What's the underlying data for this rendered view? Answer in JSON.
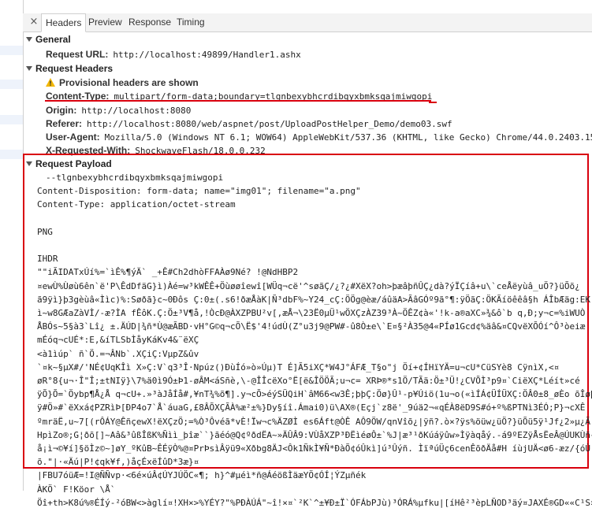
{
  "tabs": {
    "close": "×",
    "items": [
      {
        "label": "Headers"
      },
      {
        "label": "Preview"
      },
      {
        "label": "Response"
      },
      {
        "label": "Timing"
      }
    ]
  },
  "general": {
    "title": "General",
    "request_url_key": "Request URL:",
    "request_url_value": "http://localhost:49899/Handler1.ashx"
  },
  "request_headers": {
    "title": "Request Headers",
    "provisional": "Provisional headers are shown",
    "rows": [
      {
        "key": "Content-Type:",
        "value": "multipart/form-data;boundary=tlgnbexybhcrdibqyxbmksqajmiwgopi"
      },
      {
        "key": "Origin:",
        "value": "http://localhost:8080"
      },
      {
        "key": "Referer:",
        "value": "http://localhost:8080/web/aspnet/post/UploadPostHelper_Demo/demo03.swf"
      },
      {
        "key": "User-Agent:",
        "value": "Mozilla/5.0 (Windows NT 6.1; WOW64) AppleWebKit/537.36 (KHTML, like Gecko) Chrome/44.0.2403.15"
      },
      {
        "key": "X-Requested-With:",
        "value": "ShockwaveFlash/18.0.0.232"
      }
    ]
  },
  "payload": {
    "title": "Request Payload",
    "lines": [
      "--tlgnbexybhcrdibqyxbmksqajmiwgopi",
      "Content-Disposition: form-data; name=\"img01\"; filename=\"a.png\"",
      "Content-Type: application/octet-stream",
      "",
      "PNG",
      "",
      "IHDR",
      "\"\"iÃIDATxÚí%=`ìÊ%¶ýÄ` _+Ê#Ch2dhòFFAÀø9Né? !@NdHBP2",
      "¤ewÙ%Ùøù6ên`ë'P\\ÊdDfäG}ì)Àé=w³kWÊÊ+Öùøøîewî[WÜq¬cë'^søãÇ/¿?¿#XëX?oh>þæâþñÛÇ¿dà?ýÏÇíâ+u\\`ceÅëyùâ_uÖ?}üÕõ¿",
      "ã9ÿì}þ3gèùâ«Ììc)%:Søðã}c~0Ðôs Ç:0±(.s6!ðæÅàK|Ñ³dbF%~Y24_cÇ:ÖÖg@èæ/áûäA>ÃâGÓº9ã°¶:ÿÖãÇ:ÖKÃíöêêâ§h ÁÎbÆäg:EK(",
      "ì~w8GÆaZàVÌ/-æ?ÌA fÊôK.Ç:Ö±³V¶å,!ÒcÐ@ÀXZPBU²v[,æÅ¬\\23Ë0µÜ¹wÖXÇzÀZ39³À~ÖÊZ¢à«'!k-a®aXC»¾&ô`b q,Ð;y¬c=%iWUÒ",
      "ÅBÓs~5§à3`Lî¿ ±.ÄÚD|¾ñ*Ù@æÃBD·vH°G©q¬cÕ\\Ë$'4!údÙ(Z°u3j9@PW#-û8Ò±e\\`E¤§²À35@4«PÍø1Gcd¢%äâ&¤CQvëXÕÓí^Ô³òeiæ",
      "mÉóq¬cUÉ*:E,&íTLSbÌåyKáKv4&¨ëXÇ",
      "<à1ìúp` ñ`Ö.=¬ÂNb`.XÇiÇ:VµpZ&ûv",
      "`¤k~§µX#/'NÉ¢UqKÎì  X»Ç:V`q3³Î·Npúz()ÐùÍó»ò»Úµ)T     É]Ã5iXÇ*W4J°ÁFÆ_T§o\"j   Öí+¢ÍHïYÄ=u¬cU*CüSYè8 CÿnìX,<¤",
      "øR°8{u¬·Î\"Î;±tNIÿ}\\7%ä0ì9Ó±Þ1-øÂM<áSñè,\\-@ÎÎcëXo°Ë[ë&ÎÖÖÃ;u¬c=  XRÞ®*s1Ö/TÃä:Ö±³Ü!¿CVÕÌ³p9¤`CiëXÇ*Léít»cé",
      "ÿÕ}Õ=`Öybp¶Å¿Å q¬cU+.»³àJåÍå#,¥nT¾%õ¶].y¬cÕ>éýSÜQiH`âM66<w3Ê;þþÇ:Öø}Û¹-p¥Úiö(1u¬o(«ìÍÁ¢ÜÍÜXÇ:ÖÂ0±8_øÈo õÎøþ",
      "ÿ#Ö»#`ëXxá¢PZRìÞ[ÐP4o7`Å`áuaG,£8ÂÕXÇÃÀ%æ²±%}Dy§íî.Ámai0)ü\\AX®(Eçj`z8ë'_9úä2¬«qÉÀ8ëD9S#ó+º%ßPTNì3ÉÓ;P}¬cXÊ",
      "ºmräË,u~7[(rÔÁY@ÊñçewX!ëXÇzÖ;=%Ò³Ôvéã*vÈ!Ïw¬c%ÄZØÌ   es6Áft@ÒÊ AÔ9ÖW/qnVîõ¿|ÿñ?.ò×?ÿs%öüw¿üÖ?}üÕü5ÿ¹Jf¿2»µ¿Ã",
      "HpìZo®;G¦ðõ[]~Aâ&³ûßÎßK%Ñìì_þîæ``}ãéó@Q¢ºðdËA~»ÄÛÂ9:VÙåXZP³ÐËìéøÔ±`%J|æ³¹ðKúáÿûw»Ìÿàqåý.-á9ºEZÿÅsËeÂ@ÚUKÙñ{",
      "å¡ì¬©¥í]§öÌz©~]øY_ºKûB~ÊÉÿÒ%@¤PrÞsìÂÿü9«Xðbg8ÄJ<Ôk1ÑkÌ¥Ñ*ÐàÕ¢óÛkì]ú³Ûýñ. ÌïªúÜç6cenÊõðÄå#H íùjUÄ<ø6-æz/{óÙ",
      "õ.\"|·«Äú|P!¢qk¥f,)åçÉxëÍûD*3æ}¤",
      "|FBU7óüÆ=!I@ÑÑvp·<6é×úÂ¢ÚYJÚÖC«¶; h}^#µéì*ñ@ÁéößÌäæYÖ¢ÓÍ¦ÝZµñék",
      "ÀKÖ` F!Köor \\Å`",
      "Öî+th>K8ú%®ÉÍý-²óBW<>àglí¤!XH×>%YÉY?\"%PÐÀÚÁ\"~î!×¤`²K`^±¥Ð±Ï`ÓFÁbPJù)³ÓRÁ%µfku|[íHê²³èpLÑOD³äý¤JAXÉ®GD««C¹S×"
    ]
  }
}
